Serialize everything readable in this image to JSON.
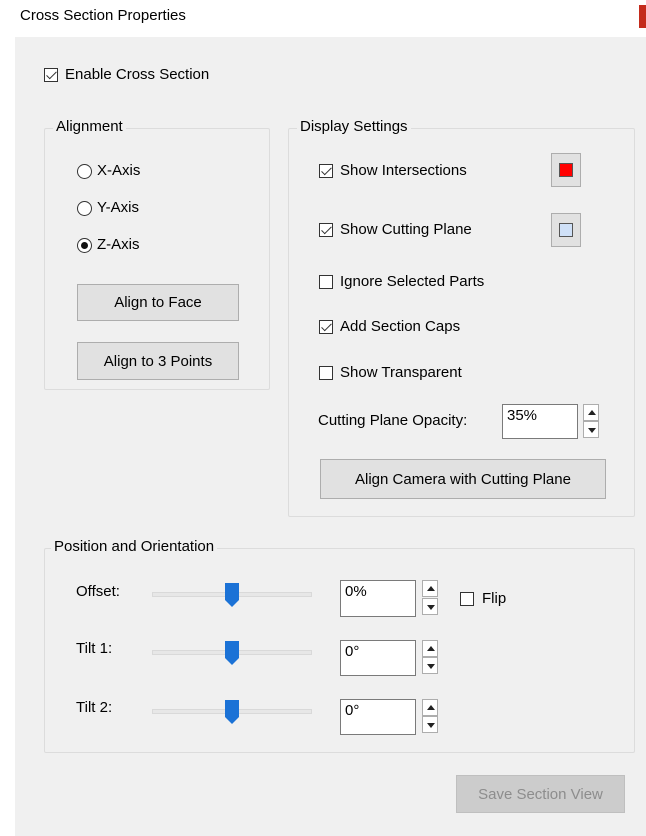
{
  "window": {
    "title": "Cross Section Properties"
  },
  "colors": {
    "accent": "#c42b1c",
    "slider_thumb": "#1b72d6",
    "intersection_color": "#ff0000",
    "cutting_plane_color": "#cfe0f7"
  },
  "enable_cross_section": {
    "label": "Enable Cross Section",
    "checked": true
  },
  "alignment": {
    "legend": "Alignment",
    "options": [
      {
        "label": "X-Axis",
        "selected": false
      },
      {
        "label": "Y-Axis",
        "selected": false
      },
      {
        "label": "Z-Axis",
        "selected": true
      }
    ],
    "align_face_label": "Align to Face",
    "align_points_label": "Align to 3 Points"
  },
  "display": {
    "legend": "Display Settings",
    "show_intersections": {
      "label": "Show Intersections",
      "checked": true
    },
    "show_cutting_plane": {
      "label": "Show Cutting Plane",
      "checked": true
    },
    "ignore_selected": {
      "label": "Ignore Selected Parts",
      "checked": false
    },
    "section_caps": {
      "label": "Add Section Caps",
      "checked": true
    },
    "transparent": {
      "label": "Show Transparent",
      "checked": false
    },
    "opacity_label": "Cutting Plane Opacity:",
    "opacity_value": "35%",
    "align_camera_label": "Align Camera with Cutting Plane"
  },
  "position": {
    "legend": "Position and Orientation",
    "offset": {
      "label": "Offset:",
      "value": "0%"
    },
    "tilt1": {
      "label": "Tilt 1:",
      "value": "0°"
    },
    "tilt2": {
      "label": "Tilt 2:",
      "value": "0°"
    },
    "slider_level": 0.5,
    "flip": {
      "label": "Flip",
      "checked": false
    }
  },
  "save_label": "Save Section View"
}
